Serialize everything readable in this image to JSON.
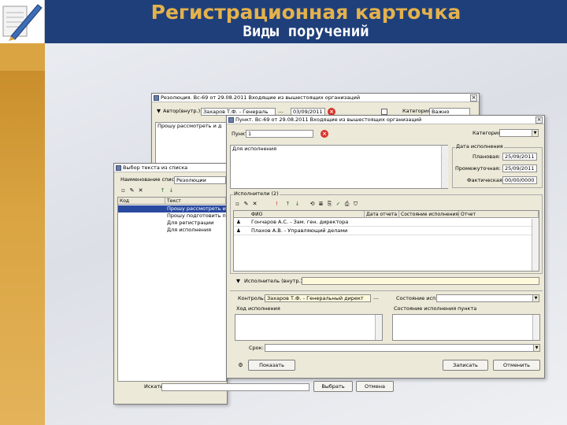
{
  "slide": {
    "title": "Регистрационная карточка",
    "subtitle": "Виды поручений"
  },
  "colors": {
    "title_bar": "#1f3f7a",
    "left_band": "#d9a441",
    "title_text": "#e4b24c",
    "window_bg": "#ece9d8",
    "selection": "#2a4aa0"
  },
  "resolution_window": {
    "title": "Резолюция. Вс-69 от 29.08.2011 Входящие из вышестоящих организаций",
    "author_label": "Автор(внутр.):",
    "author_value": "Захаров Т.Ф. - Генераль",
    "date_value": "03/09/2011",
    "category_label": "Категория:",
    "category_value": "Важно",
    "text_value": "Прошу рассмотреть и д"
  },
  "select_text_window": {
    "title": "Выбор текста из списка",
    "list_name_label": "Наименование списка:",
    "list_name_value": "Резолюции",
    "columns": [
      "Код",
      "Текст"
    ],
    "rows": [
      "Прошу рассмотреть и ра",
      "Прошу подготовить пре",
      "Для регистрации",
      "Для исполнения"
    ],
    "search_label": "Искать:",
    "select_button": "Выбрать",
    "cancel_button": "Отмена"
  },
  "item_window": {
    "title": "Пункт. Вс-69 от 29.08.2011 Входящие из вышестоящих организаций",
    "number_label": "Пункт №:",
    "number_value": "1",
    "category_label": "Категория:",
    "text_value": "Для исполнения",
    "execution_date_label": "Дата исполнения",
    "plan_label": "Плановая:",
    "plan_value": "25/09/2011",
    "interim_label": "Промежуточная:",
    "interim_value": "25/09/2011",
    "actual_label": "Фактическая:",
    "actual_value": "00/00/0000",
    "executors_label": "Исполнители (2)",
    "grid_columns": [
      "ФИО",
      "Дата отчета",
      "Состояние исполнения",
      "Отчет"
    ],
    "executors": [
      {
        "name": "Гончаров А.С. - Зам. ген. директора"
      },
      {
        "name": "Плахов А.В. - Управляющий делами"
      }
    ],
    "initiator_label": "Исполнитель (внутр.):",
    "control_label": "Контроль:",
    "control_value": "Захаров Т.Ф. - Генеральный директ",
    "state_label": "Состояние исп.:",
    "progress_label": "Ход исполнения",
    "state_text_label": "Состояние исполнения пункта",
    "term_label": "Срок:",
    "add_button": "Показать",
    "save_button": "Записать",
    "cancel_button": "Отменить"
  }
}
